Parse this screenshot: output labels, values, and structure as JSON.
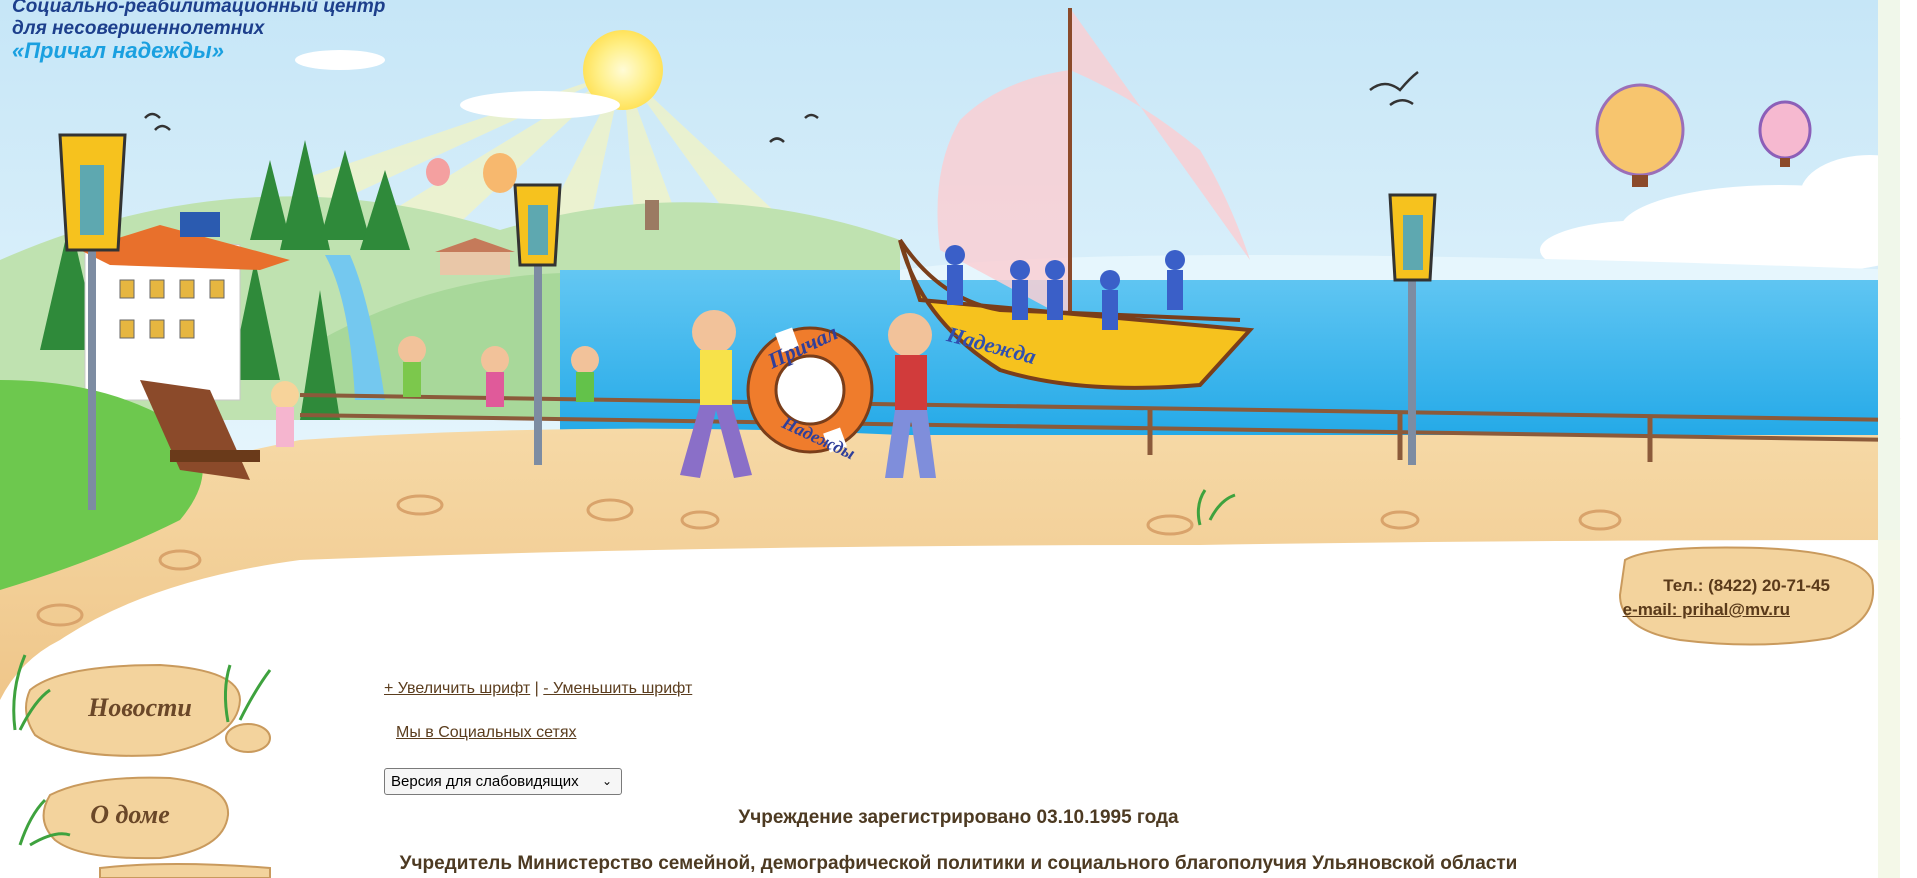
{
  "header": {
    "title_line1": "Социально-реабилитационный центр",
    "title_line2": "для несовершеннолетних",
    "brand_name": "«Причал надежды»",
    "lifebuoy_line1": "Причал",
    "lifebuoy_line2": "Надежды",
    "boat_name": "Надежда"
  },
  "contacts": {
    "phone": "Тел.: (8422) 20-71-45",
    "email": "e-mail: prihal@mv.ru"
  },
  "nav": {
    "items": [
      {
        "label": "Новости"
      },
      {
        "label": "О доме"
      }
    ]
  },
  "toolbar": {
    "increase_font": "+ Увеличить шрифт",
    "separator": "|",
    "decrease_font": "- Уменьшить шрифт",
    "social_link": "Мы в Социальных сетях",
    "version_select": "Версия для слабовидящих"
  },
  "main": {
    "registration": "Учреждение зарегистрировано 03.10.1995 года",
    "founder": "Учредитель Министерство семейной, демографической политики и социального благополучия Ульяновской области"
  },
  "colors": {
    "sky_top": "#cfeaf8",
    "sea": "#3cb8ee",
    "sand": "#f3cf98",
    "title_blue": "#1d3f8c",
    "brand_cyan": "#1aa0e0",
    "text_brown": "#5b3d1e"
  }
}
